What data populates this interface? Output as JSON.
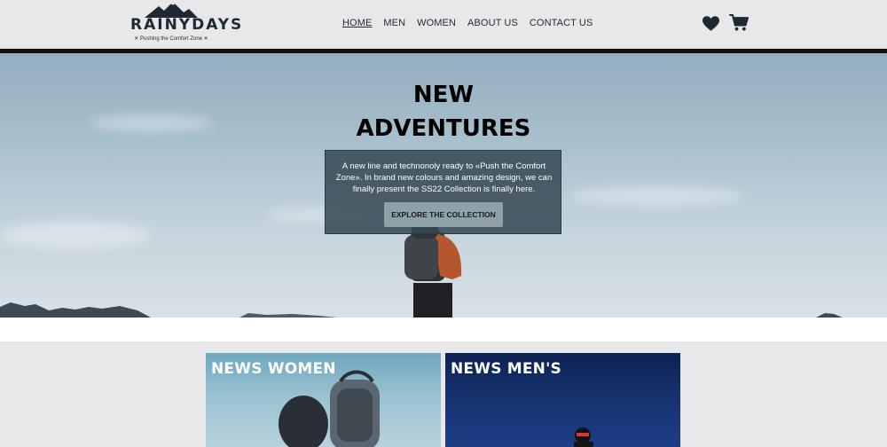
{
  "brand": {
    "name": "RAINYDAYS",
    "tagline": "✕ Pushing the Comfort Zone ✕"
  },
  "nav": {
    "items": [
      "HOME",
      "MEN",
      "WOMEN",
      "ABOUT US",
      "CONTACT US"
    ],
    "active": "HOME"
  },
  "header_icons": [
    "heart-icon",
    "cart-icon"
  ],
  "hero": {
    "title_line1": "NEW",
    "title_line2": "ADVENTURES",
    "description": "A new line and technonoly ready to «Push the Comfort Zone». In brand new colours and amazing design, we can finally present the SS22 Collection is finally here.",
    "button": "EXPLORE THE COLLECTION"
  },
  "cards": [
    {
      "title": "NEWS WOMEN"
    },
    {
      "title": "NEWS MEN'S"
    }
  ],
  "colors": {
    "header_bg": "#e8e8ea",
    "header_rule": "#111111",
    "hero_box": "#344852",
    "hero_button": "#8ea2a8",
    "men_card": "#173372"
  }
}
